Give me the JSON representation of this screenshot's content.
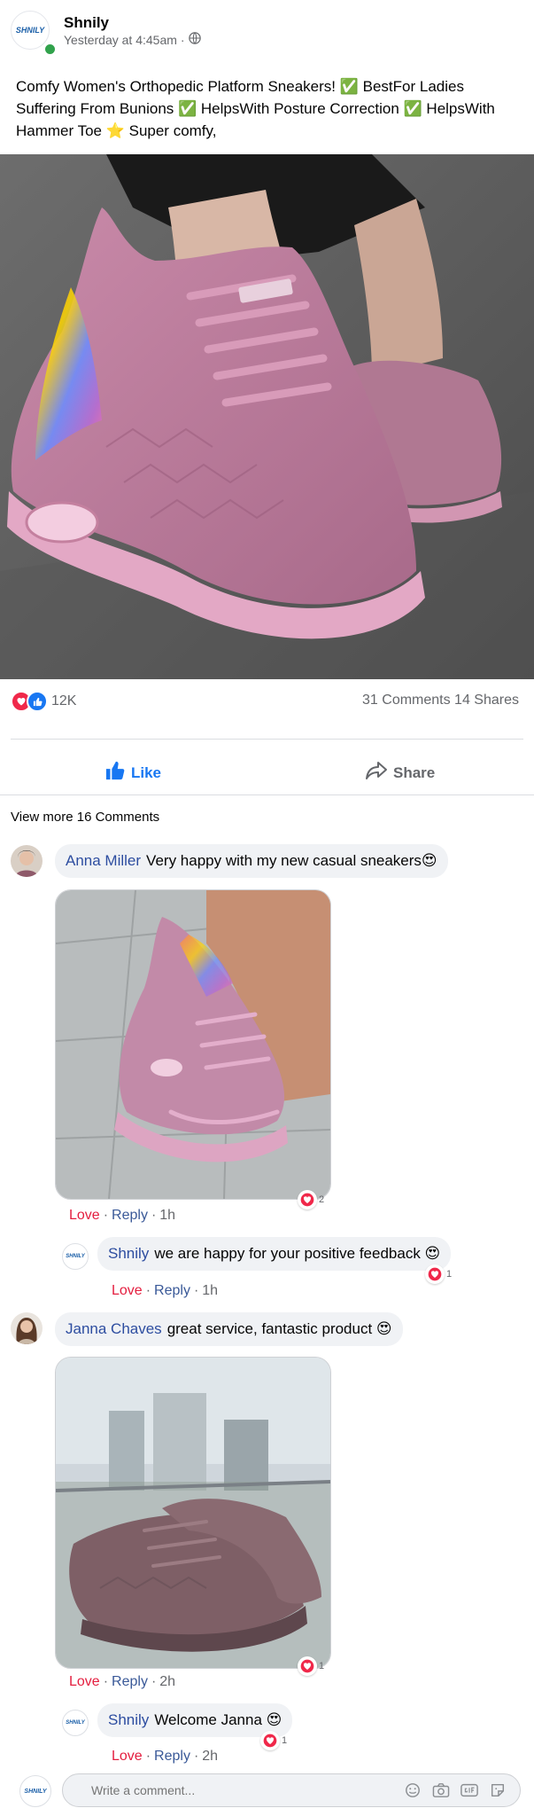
{
  "post": {
    "page_name": "Shnily",
    "logo_text": "SHNILY",
    "timestamp": "Yesterday at 4:45am",
    "separator": "·",
    "text": "Comfy Women's Orthopedic Platform Sneakers! ✅ BestFor Ladies Suffering From Bunions ✅ HelpsWith Posture Correction ✅ HelpsWith Hammer Toe ⭐ Super comfy,",
    "reactions_count": "12K",
    "comments_shares": "31 Comments 14 Shares"
  },
  "actions": {
    "like": "Like",
    "share": "Share"
  },
  "view_more": "View more 16 Comments",
  "comments": [
    {
      "author": "Anna Miller",
      "text": "Very happy with my new casual sneakers😍",
      "love": "Love",
      "reply": "Reply",
      "time": "1h",
      "reaction_count": "2"
    },
    {
      "author": "Shnily",
      "text": "we are happy for your positive feedback 😍",
      "love": "Love",
      "reply": "Reply",
      "time": "1h",
      "reaction_count": "1"
    },
    {
      "author": "Janna Chaves",
      "text": "great service, fantastic product 😍",
      "love": "Love",
      "reply": "Reply",
      "time": "2h",
      "reaction_count": "1"
    },
    {
      "author": "Shnily",
      "text": "Welcome Janna 😍",
      "love": "Love",
      "reply": "Reply",
      "time": "2h",
      "reaction_count": "1"
    }
  ],
  "composer": {
    "placeholder": "Write a comment..."
  },
  "colors": {
    "like_blue": "#1877f2",
    "love_red": "#e41e3f",
    "author_blue": "#2d4da0",
    "online_green": "#31a24c"
  }
}
